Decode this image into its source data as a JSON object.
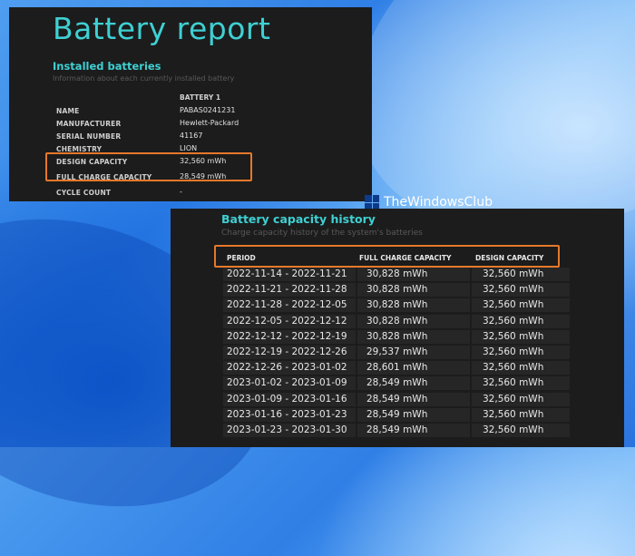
{
  "installed": {
    "title": "Battery report",
    "section_title": "Installed batteries",
    "section_subtitle": "Information about each currently installed battery",
    "column_header": "BATTERY 1",
    "rows": [
      {
        "label": "NAME",
        "value": "PABAS0241231"
      },
      {
        "label": "MANUFACTURER",
        "value": "Hewlett-Packard"
      },
      {
        "label": "SERIAL NUMBER",
        "value": "41167"
      },
      {
        "label": "CHEMISTRY",
        "value": "LION"
      },
      {
        "label": "DESIGN CAPACITY",
        "value": "32,560 mWh"
      },
      {
        "label": "FULL CHARGE CAPACITY",
        "value": "28,549 mWh"
      },
      {
        "label": "CYCLE COUNT",
        "value": "-"
      }
    ]
  },
  "watermark": {
    "text": "TheWindowsClub"
  },
  "history": {
    "title": "Battery capacity history",
    "subtitle": "Charge capacity history of the system's batteries",
    "headers": {
      "period": "PERIOD",
      "full": "FULL CHARGE CAPACITY",
      "design": "DESIGN CAPACITY"
    },
    "rows": [
      {
        "period": "2022-11-14 - 2022-11-21",
        "full": "30,828 mWh",
        "design": "32,560 mWh"
      },
      {
        "period": "2022-11-21 - 2022-11-28",
        "full": "30,828 mWh",
        "design": "32,560 mWh"
      },
      {
        "period": "2022-11-28 - 2022-12-05",
        "full": "30,828 mWh",
        "design": "32,560 mWh"
      },
      {
        "period": "2022-12-05 - 2022-12-12",
        "full": "30,828 mWh",
        "design": "32,560 mWh"
      },
      {
        "period": "2022-12-12 - 2022-12-19",
        "full": "30,828 mWh",
        "design": "32,560 mWh"
      },
      {
        "period": "2022-12-19 - 2022-12-26",
        "full": "29,537 mWh",
        "design": "32,560 mWh"
      },
      {
        "period": "2022-12-26 - 2023-01-02",
        "full": "28,601 mWh",
        "design": "32,560 mWh"
      },
      {
        "period": "2023-01-02 - 2023-01-09",
        "full": "28,549 mWh",
        "design": "32,560 mWh"
      },
      {
        "period": "2023-01-09 - 2023-01-16",
        "full": "28,549 mWh",
        "design": "32,560 mWh"
      },
      {
        "period": "2023-01-16 - 2023-01-23",
        "full": "28,549 mWh",
        "design": "32,560 mWh"
      },
      {
        "period": "2023-01-23 - 2023-01-30",
        "full": "28,549 mWh",
        "design": "32,560 mWh"
      }
    ]
  },
  "colors": {
    "accent": "#3fd0d3",
    "highlight": "#e6782a",
    "panel": "#1c1c1c"
  }
}
